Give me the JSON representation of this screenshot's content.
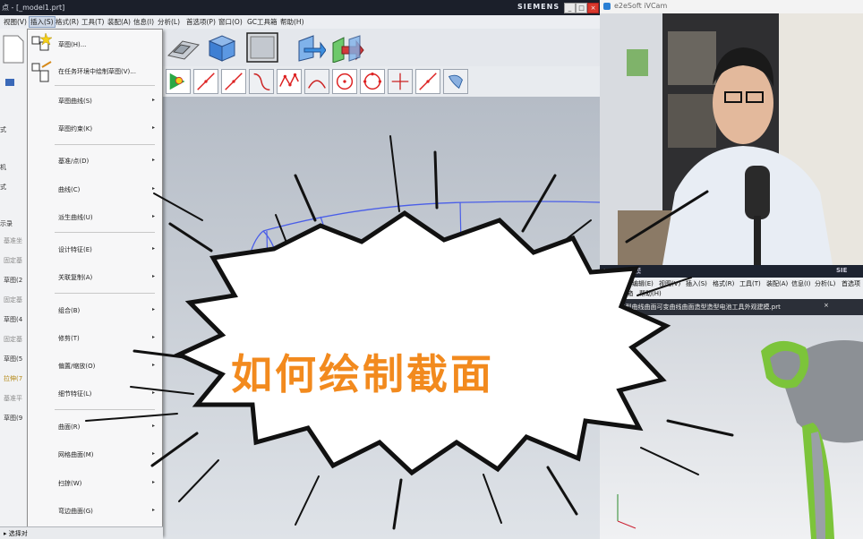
{
  "nx": {
    "title": "点 - [_model1.prt]",
    "brand": "SIEMENS",
    "window_buttons": [
      "_",
      "□",
      "×"
    ],
    "menu": [
      "视图(V)",
      "插入(S)",
      "格式(R)",
      "工具(T)",
      "装配(A)",
      "信息(I)",
      "分析(L)",
      "首选项(P)",
      "窗口(O)",
      "GC工具箱",
      "帮助(H)"
    ]
  },
  "left_panel": {
    "rows": [
      "式",
      "机",
      "式",
      "示录",
      "基准坐",
      "固定基",
      "草图(2",
      "固定基",
      "草图(4",
      "固定基",
      "草图(5",
      "拉伸(7",
      "基准平",
      "草图(9"
    ]
  },
  "dropdown": {
    "items": [
      {
        "label": "草图(H)...",
        "arrow": ""
      },
      {
        "label": "在任务环境中绘制草图(V)...",
        "arrow": ""
      },
      {
        "label": "草图曲线(S)",
        "arrow": "▸"
      },
      {
        "label": "草图约束(K)",
        "arrow": "▸"
      },
      {
        "label": "基准/点(D)",
        "arrow": "▸"
      },
      {
        "label": "曲线(C)",
        "arrow": "▸"
      },
      {
        "label": "派生曲线(U)",
        "arrow": "▸"
      },
      {
        "label": "设计特征(E)",
        "arrow": "▸"
      },
      {
        "label": "关联复制(A)",
        "arrow": "▸"
      },
      {
        "label": "组合(B)",
        "arrow": "▸"
      },
      {
        "label": "修剪(T)",
        "arrow": "▸"
      },
      {
        "label": "偏置/缩放(O)",
        "arrow": "▸"
      },
      {
        "label": "细节特征(L)",
        "arrow": "▸"
      },
      {
        "label": "曲面(R)",
        "arrow": "▸"
      },
      {
        "label": "网格曲面(M)",
        "arrow": "▸"
      },
      {
        "label": "扫掠(W)",
        "arrow": "▸"
      },
      {
        "label": "弯边曲面(G)",
        "arrow": "▸"
      }
    ]
  },
  "statusbar": {
    "label": "▸ 选择对"
  },
  "webcam": {
    "title": "e2eSoft iVCam"
  },
  "nx2": {
    "title": "NX 12 - 建模",
    "brand": "SIE",
    "menu_row1": [
      "文件(F)",
      "编辑(E)",
      "视图(V)",
      "插入(S)",
      "格式(R)",
      "工具(T)",
      "装配(A)",
      "信息(I)",
      "分析(L)",
      "首选项"
    ],
    "menu_row2": [
      "GC工具箱",
      "帮助(H)"
    ],
    "tab": "5-UG造型曲线曲面可变曲线曲面造型造型电池工具外观建模.prt"
  },
  "overlay": {
    "text": "如何绘制截面"
  },
  "colors": {
    "accent": "#f28a1e",
    "curve": "#4a5ee8",
    "titlebar": "#1b1f2a"
  }
}
